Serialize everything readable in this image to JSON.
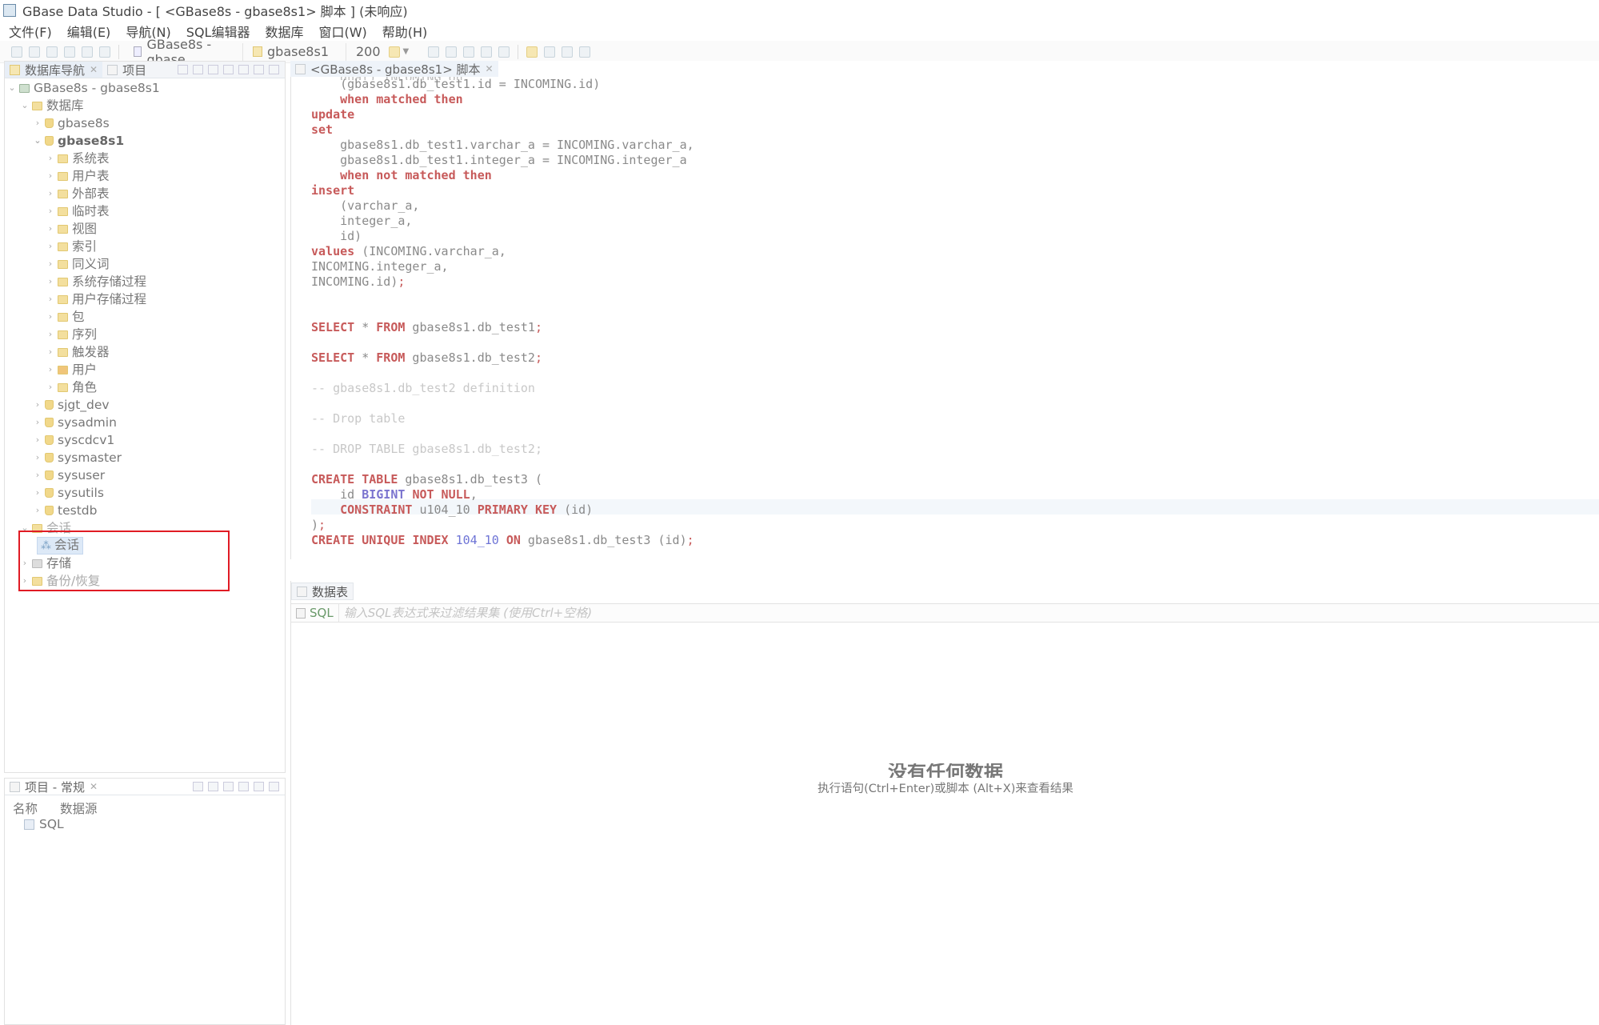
{
  "window": {
    "title": "GBase Data Studio - [ <GBase8s - gbase8s1> 脚本 ] (未响应)"
  },
  "menu": [
    "文件(F)",
    "编辑(E)",
    "导航(N)",
    "SQL编辑器",
    "数据库",
    "窗口(W)",
    "帮助(H)"
  ],
  "toolbar": {
    "connection": "GBase8s - gbase",
    "schema": "gbase8s1",
    "limit": "200"
  },
  "nav_panel": {
    "tabs": [
      "数据库导航",
      "项目"
    ],
    "tree": {
      "root": "GBase8s - gbase8s1",
      "databases_label": "数据库",
      "db_gbase8s": "gbase8s",
      "db_gbase8s1": "gbase8s1",
      "children": [
        "系统表",
        "用户表",
        "外部表",
        "临时表",
        "视图",
        "索引",
        "同义词",
        "系统存储过程",
        "用户存储过程",
        "包",
        "序列",
        "触发器",
        "用户",
        "角色"
      ],
      "other_dbs": [
        "sjgt_dev",
        "sysadmin",
        "syscdcv1",
        "sysmaster",
        "sysuser",
        "sysutils",
        "testdb"
      ],
      "session_group": "会话",
      "session_item": "会话",
      "storage": "存储",
      "backup": "备份/恢复"
    }
  },
  "project_panel": {
    "title": "项目 - 常规",
    "col_name": "名称",
    "col_source": "数据源",
    "row": "SQL"
  },
  "editor": {
    "tab_label": "<GBase8s - gbase8s1> 脚本",
    "lines": {
      "l0": "    dual) INCOMING on",
      "l1": "    (gbase8s1.db_test1.id = INCOMING.id)",
      "l2_kw": "when matched then",
      "l3": "update",
      "l4": "set",
      "l5": "    gbase8s1.db_test1.varchar_a = INCOMING.varchar_a,",
      "l6": "    gbase8s1.db_test1.integer_a = INCOMING.integer_a",
      "l7_kw": "when not matched then",
      "l8": "insert",
      "l9": "    (varchar_a,",
      "l10": "    integer_a,",
      "l11": "    id)",
      "l12_kw": "values",
      "l12_rest": " (INCOMING.varchar_a,",
      "l13": "INCOMING.integer_a,",
      "l14": "INCOMING.id)",
      "l14_semi": ";",
      "select": "SELECT",
      "star": " * ",
      "from": "FROM",
      "t1": " gbase8s1.db_test1",
      "t2": " gbase8s1.db_test2",
      "semi": ";",
      "c1": "-- gbase8s1.db_test2 definition",
      "c2": "-- Drop table",
      "c3": "-- DROP TABLE gbase8s1.db_test2;",
      "create": "CREATE",
      "table": "TABLE",
      "t3": " gbase8s1.db_test3 (",
      "id_col": "    id ",
      "bigint": "BIGINT",
      "notnull": "NOT NULL",
      "comma": ",",
      "constraint": "CONSTRAINT",
      "cname": " u104_10 ",
      "pk": "PRIMARY KEY",
      "pkcol": " (id)",
      "close": ")",
      "unique": "UNIQUE",
      "index": "INDEX",
      "idxnum": "104_10",
      "on": "ON",
      "idxtail": " gbase8s1.db_test3 (id)"
    }
  },
  "results": {
    "tab_label": "数据表",
    "sql_button": "SQL",
    "filter_placeholder": "输入SQL表达式来过滤结果集 (使用Ctrl+空格)",
    "no_data_title": "没有任何数据",
    "no_data_hint": "执行语句(Ctrl+Enter)或脚本 (Alt+X)来查看结果"
  }
}
